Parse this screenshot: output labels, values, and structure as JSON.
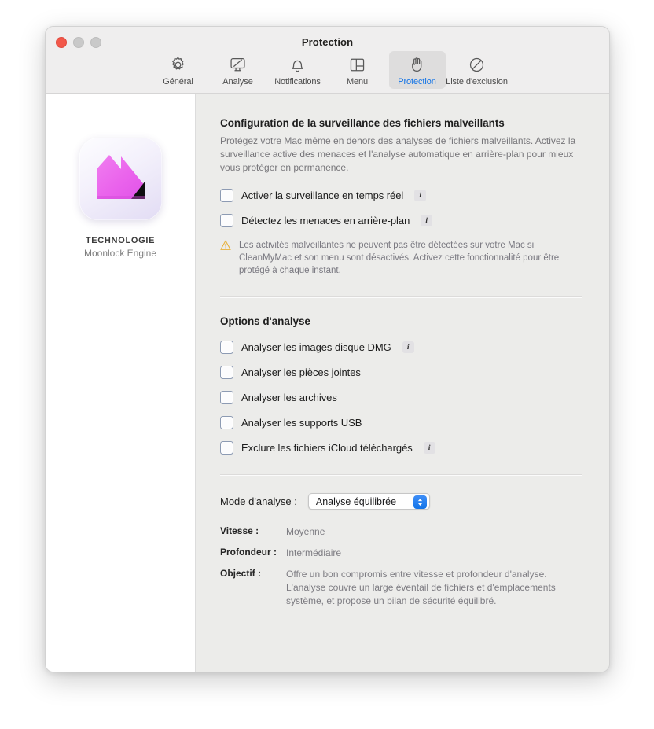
{
  "window": {
    "title": "Protection",
    "traffic_lights": [
      "close",
      "minimize",
      "zoom"
    ]
  },
  "toolbar": {
    "items": [
      {
        "label": "Général",
        "icon": "gear-icon",
        "selected": false
      },
      {
        "label": "Analyse",
        "icon": "monitor-scan-icon",
        "selected": false
      },
      {
        "label": "Notifications",
        "icon": "bell-icon",
        "selected": false
      },
      {
        "label": "Menu",
        "icon": "menubar-layout-icon",
        "selected": false
      },
      {
        "label": "Protection",
        "icon": "hand-stop-icon",
        "selected": true
      },
      {
        "label": "Liste d'exclusion",
        "icon": "no-entry-icon",
        "selected": false
      }
    ]
  },
  "sidebar": {
    "app_icon_name": "moonlock-engine-app-icon",
    "caption": "TECHNOLOGIE",
    "subtitle": "Moonlock Engine"
  },
  "main": {
    "malware_section": {
      "title": "Configuration de la surveillance des fichiers malveillants",
      "description": "Protégez votre Mac même en dehors des analyses de fichiers malveillants. Activez la surveillance active des menaces et l'analyse automatique en arrière-plan pour mieux vous protéger en permanence.",
      "options": [
        {
          "label": "Activer la surveillance en temps réel",
          "checked": false,
          "info": "i"
        },
        {
          "label": "Détectez les menaces en arrière-plan",
          "checked": false,
          "info": "i"
        }
      ],
      "warning": {
        "icon": "warning-triangle-icon",
        "text": "Les activités malveillantes ne peuvent pas être détectées sur votre Mac si CleanMyMac et son menu sont désactivés. Activez cette fonctionnalité pour être protégé à chaque instant."
      }
    },
    "scan_options_section": {
      "title": "Options d'analyse",
      "options": [
        {
          "label": "Analyser les images disque DMG",
          "checked": false,
          "info": "i"
        },
        {
          "label": "Analyser les pièces jointes",
          "checked": false,
          "info": null
        },
        {
          "label": "Analyser les archives",
          "checked": false,
          "info": null
        },
        {
          "label": "Analyser les supports USB",
          "checked": false,
          "info": null
        },
        {
          "label": "Exclure les fichiers iCloud téléchargés",
          "checked": false,
          "info": "i"
        }
      ]
    },
    "mode_section": {
      "label": "Mode d'analyse :",
      "selected": "Analyse équilibrée",
      "details": [
        {
          "key": "Vitesse :",
          "value": "Moyenne"
        },
        {
          "key": "Profondeur :",
          "value": "Intermédiaire"
        },
        {
          "key": "Objectif :",
          "value": "Offre un bon compromis entre vitesse et profondeur d'analyse. L'analyse couvre un large éventail de fichiers et d'emplacements système, et propose un bilan de sécurité équilibré."
        }
      ]
    }
  },
  "colors": {
    "accent": "#1273e6",
    "warning": "#e8b13a",
    "window_bg": "#ececea",
    "sidebar_bg": "#ffffff",
    "titlebar_bg": "#efeeee"
  }
}
